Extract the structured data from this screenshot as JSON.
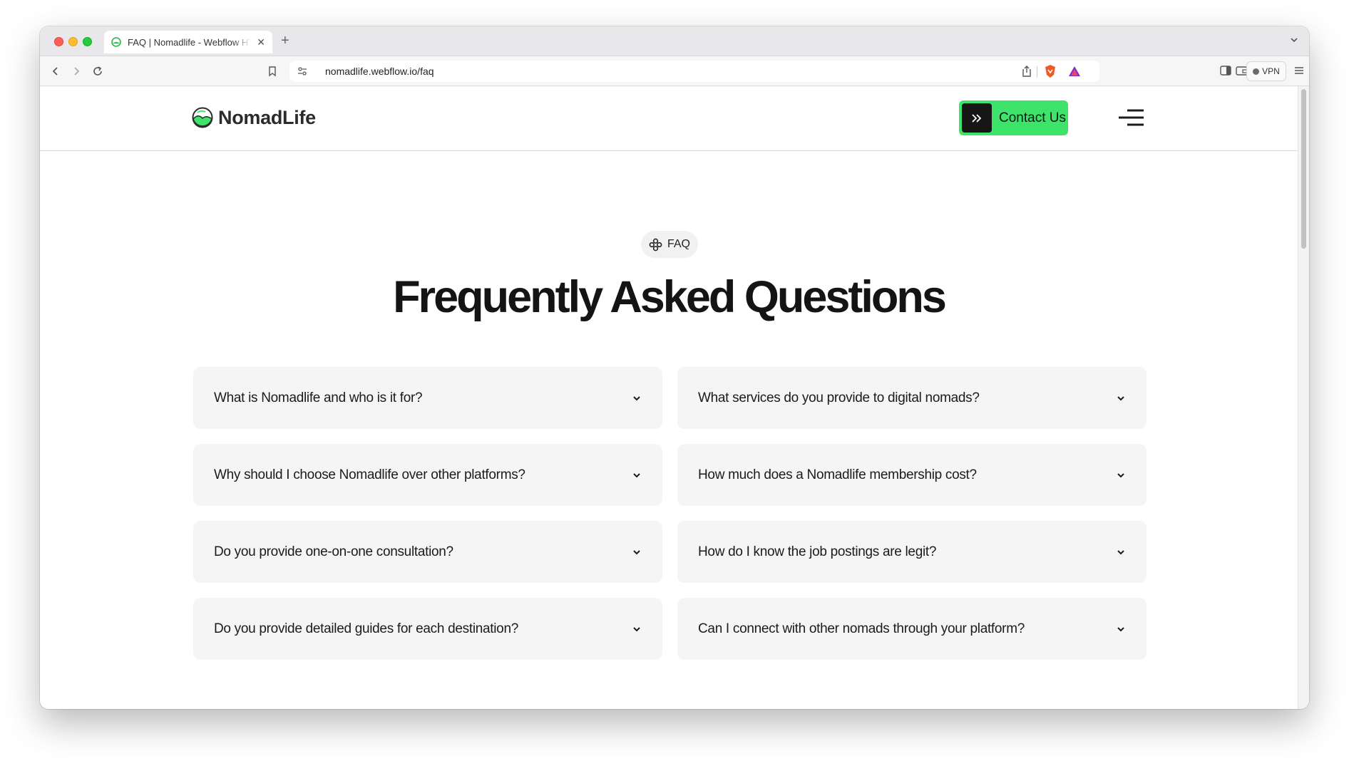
{
  "browser": {
    "tab_title": "FAQ | Nomadlife - Webflow HTML website template",
    "new_tab_symbol": "+",
    "close_symbol": "✕",
    "url": "nomadlife.webflow.io/faq",
    "vpn_label": "VPN"
  },
  "site": {
    "logo_text": "NomadLife",
    "contact_label": "Contact Us",
    "brand_color": "#3ee46a"
  },
  "faq": {
    "badge": "FAQ",
    "heading": "Frequently Asked Questions",
    "questions": [
      "What is Nomadlife and who is it for?",
      "What services do you provide to digital nomads?",
      "Why should I choose Nomadlife over other platforms?",
      "How much does a Nomadlife membership cost?",
      "Do you provide one-on-one consultation?",
      "How do I know the job postings are legit?",
      "Do you provide detailed guides for each destination?",
      "Can I connect with other nomads through your platform?"
    ]
  }
}
